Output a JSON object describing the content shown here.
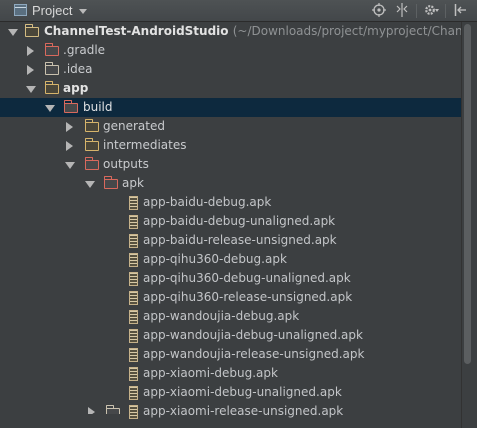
{
  "header": {
    "title": "Project",
    "icons": [
      "target-icon",
      "collapse-split-icon",
      "gear-icon",
      "hide-panel-icon"
    ]
  },
  "tree": {
    "root": {
      "name": "ChannelTest-AndroidStudio",
      "path": "(~/Downloads/project/myproject/Chann"
    },
    "gradle": ".gradle",
    "idea": ".idea",
    "app": "app",
    "build": "build",
    "generated": "generated",
    "intermediates": "intermediates",
    "outputs": "outputs",
    "apk": "apk",
    "files": [
      "app-baidu-debug.apk",
      "app-baidu-debug-unaligned.apk",
      "app-baidu-release-unsigned.apk",
      "app-qihu360-debug.apk",
      "app-qihu360-debug-unaligned.apk",
      "app-qihu360-release-unsigned.apk",
      "app-wandoujia-debug.apk",
      "app-wandoujia-debug-unaligned.apk",
      "app-wandoujia-release-unsigned.apk",
      "app-xiaomi-debug.apk",
      "app-xiaomi-debug-unaligned.apk",
      "app-xiaomi-release-unsigned.apk"
    ]
  },
  "colors": {
    "background": "#3c3f41",
    "selection": "#0d293e",
    "excluded_folder": "#d9695d"
  }
}
